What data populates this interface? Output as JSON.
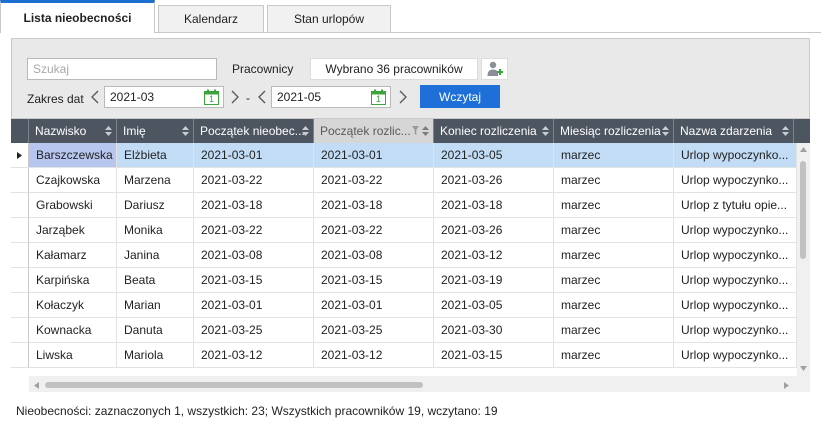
{
  "tabs": [
    {
      "label": "Lista nieobecności",
      "active": true
    },
    {
      "label": "Kalendarz",
      "active": false
    },
    {
      "label": "Stan urlopów",
      "active": false
    }
  ],
  "filters": {
    "search_placeholder": "Szukaj",
    "employees_label": "Pracownicy",
    "employees_button": "Wybrano 36 pracowników",
    "date_range_label": "Zakres dat",
    "date_from": "2021-03",
    "date_separator": "-",
    "date_to": "2021-05",
    "load_button": "Wczytaj",
    "calendar_day": "1"
  },
  "table": {
    "columns": [
      "Nazwisko",
      "Imię",
      "Początek nieobec...",
      "Początek rozlic...",
      "Koniec rozliczenia",
      "Miesiąc rozliczenia",
      "Nazwa zdarzenia"
    ],
    "rows": [
      [
        "Barszczewska",
        "Elżbieta",
        "2021-03-01",
        "2021-03-01",
        "2021-03-05",
        "marzec",
        "Urlop wypoczynko..."
      ],
      [
        "Czajkowska",
        "Marzena",
        "2021-03-22",
        "2021-03-22",
        "2021-03-26",
        "marzec",
        "Urlop wypoczynko..."
      ],
      [
        "Grabowski",
        "Dariusz",
        "2021-03-18",
        "2021-03-18",
        "2021-03-18",
        "marzec",
        "Urlop z tytułu opie..."
      ],
      [
        "Jarząbek",
        "Monika",
        "2021-03-22",
        "2021-03-22",
        "2021-03-26",
        "marzec",
        "Urlop wypoczynko..."
      ],
      [
        "Kałamarz",
        "Janina",
        "2021-03-08",
        "2021-03-08",
        "2021-03-12",
        "marzec",
        "Urlop wypoczynko..."
      ],
      [
        "Karpińska",
        "Beata",
        "2021-03-15",
        "2021-03-15",
        "2021-03-19",
        "marzec",
        "Urlop wypoczynko..."
      ],
      [
        "Kołaczyk",
        "Marian",
        "2021-03-01",
        "2021-03-01",
        "2021-03-05",
        "marzec",
        "Urlop wypoczynko..."
      ],
      [
        "Kownacka",
        "Danuta",
        "2021-03-25",
        "2021-03-25",
        "2021-03-30",
        "marzec",
        "Urlop wypoczynko..."
      ],
      [
        "Liwska",
        "Mariola",
        "2021-03-12",
        "2021-03-12",
        "2021-03-15",
        "marzec",
        "Urlop wypoczynko..."
      ]
    ],
    "selected_row": 0,
    "sorted_column": 3
  },
  "status": "Nieobecności: zaznaczonych 1, wszystkich: 23;  Wszystkich pracowników 19, wczytano: 19",
  "colors": {
    "accent": "#1f6fd8",
    "header_bg": "#4d5561",
    "selection": "#c2dcf6",
    "calendar_green": "#3aa53a"
  }
}
